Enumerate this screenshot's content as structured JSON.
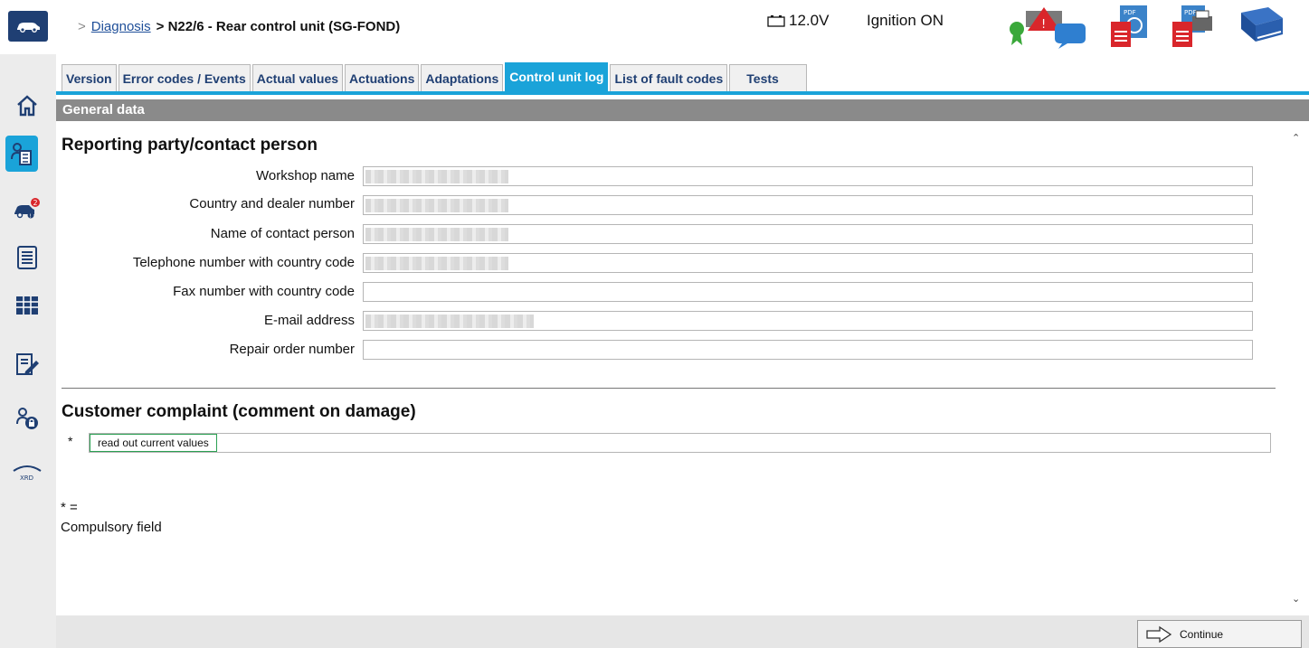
{
  "header": {
    "breadcrumb_sep": ">",
    "breadcrumb_link": "Diagnosis",
    "breadcrumb_current": "> N22/6 - Rear control unit (SG-FOND)",
    "voltage": "12.0V",
    "ignition": "Ignition ON"
  },
  "sidebar": {
    "icons": [
      "home-icon",
      "diagnosis-icon",
      "fault-car-icon",
      "list-icon",
      "grid-icon",
      "edit-icon",
      "secure-diagnosis-icon",
      "xrd-icon"
    ],
    "badge_count": "2",
    "xrd_label": "XRD"
  },
  "tabs": [
    "Version",
    "Error codes / Events",
    "Actual values",
    "Actuations",
    "Adaptations",
    "Control unit log",
    "List of fault codes",
    "Tests"
  ],
  "active_tab": "Control unit log",
  "section_bar": "General data",
  "reporting": {
    "heading": "Reporting party/contact person",
    "fields": [
      {
        "label": "Workshop name",
        "value": ""
      },
      {
        "label": "Country and dealer number",
        "value": ""
      },
      {
        "label": "Name of contact person",
        "value": ""
      },
      {
        "label": "Telephone number with country code",
        "value": ""
      },
      {
        "label": "Fax number with country code",
        "value": ""
      },
      {
        "label": "E-mail address",
        "value": ""
      },
      {
        "label": "Repair order number",
        "value": ""
      }
    ]
  },
  "complaint": {
    "heading": "Customer complaint (comment on damage)",
    "asterisk": "*",
    "value": "read out current values"
  },
  "footnote": {
    "line1": "* =",
    "line2": "Compulsory field"
  },
  "footer": {
    "continue_label": "Continue"
  },
  "colors": {
    "accent": "#1aa3d9",
    "brand": "#1f3f73",
    "section_bar": "#8a8a8a"
  }
}
